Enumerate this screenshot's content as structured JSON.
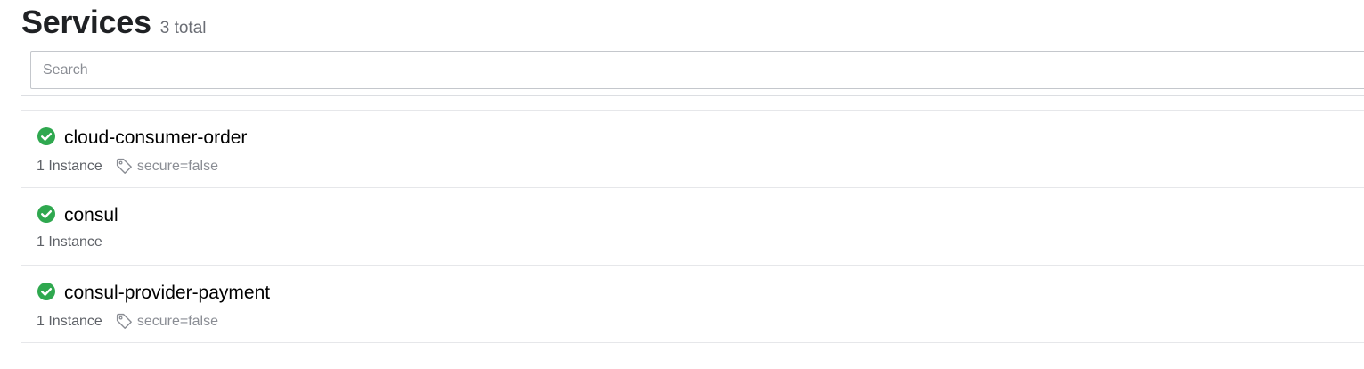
{
  "page": {
    "title": "Services",
    "count_label": "3 total"
  },
  "search": {
    "placeholder": "Search",
    "value": ""
  },
  "colors": {
    "healthy": "#2fa84f"
  },
  "services": [
    {
      "name": "cloud-consumer-order",
      "status_icon": "check-circle-icon",
      "instances": "1 Instance",
      "tag_icon": "tag-icon",
      "tag": "secure=false"
    },
    {
      "name": "consul",
      "status_icon": "check-circle-icon",
      "instances": "1 Instance"
    },
    {
      "name": "consul-provider-payment",
      "status_icon": "check-circle-icon",
      "instances": "1 Instance",
      "tag_icon": "tag-icon",
      "tag": "secure=false"
    }
  ]
}
